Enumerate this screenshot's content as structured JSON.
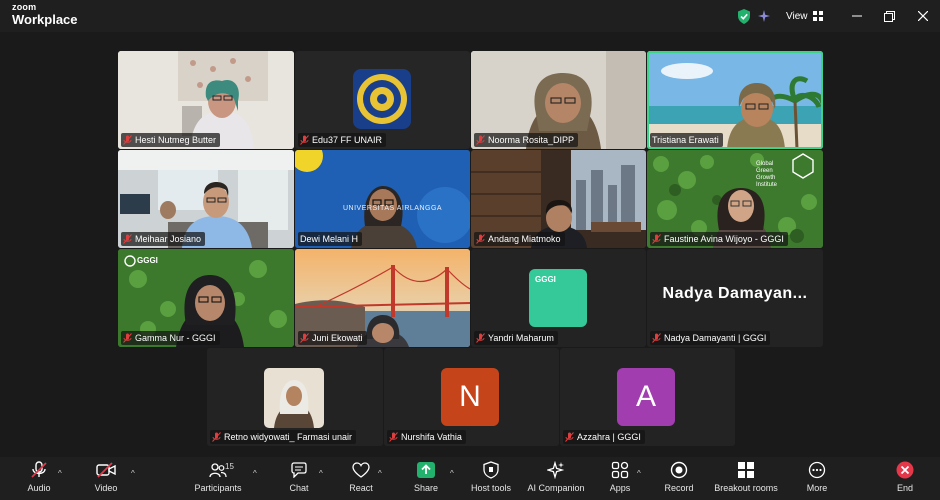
{
  "app": {
    "logo_line1": "zoom",
    "logo_line2": "Workplace"
  },
  "titlebar": {
    "view_label": "View"
  },
  "participants": [
    {
      "name": "Hesti Nutmeg Butter",
      "muted": true
    },
    {
      "name": "Edu37 FF UNAIR",
      "muted": true
    },
    {
      "name": "Noorma Rosita_DIPP",
      "muted": true
    },
    {
      "name": "Tristiana Erawati",
      "muted": false,
      "active": true
    },
    {
      "name": "Meihaar Josiano",
      "muted": true
    },
    {
      "name": "Dewi Melani H",
      "muted": false
    },
    {
      "name": "Andang Miatmoko",
      "muted": true
    },
    {
      "name": "Faustine Avina Wijoyo - GGGI",
      "muted": true
    },
    {
      "name": "Gamma Nur - GGGI",
      "muted": true
    },
    {
      "name": "Juni Ekowati",
      "muted": true
    },
    {
      "name": "Yandri Maharum",
      "muted": true
    },
    {
      "name": "Nadya Damayanti | GGGI",
      "muted": true,
      "display_text": "Nadya  Damayan..."
    },
    {
      "name": "Retno widyowati_ Farmasi unair",
      "muted": true
    },
    {
      "name": "Nurshifa Vathia",
      "muted": true,
      "avatar_letter": "N",
      "avatar_color": "#c6441a"
    },
    {
      "name": "Azzahra | GGGI",
      "muted": true,
      "avatar_letter": "A",
      "avatar_color": "#a23db0"
    }
  ],
  "tile_text": {
    "gggi_logo": "GGGI",
    "faustine_logo": "Global Green Growth Institute",
    "dewi_banner": "UNIVERSITAS AIRLANGGA"
  },
  "toolbar": {
    "audio": "Audio",
    "video": "Video",
    "participants": "Participants",
    "participants_count": "15",
    "chat": "Chat",
    "react": "React",
    "share": "Share",
    "host_tools": "Host tools",
    "ai_companion": "AI Companion",
    "apps": "Apps",
    "record": "Record",
    "breakout": "Breakout rooms",
    "more": "More",
    "end": "End"
  },
  "colors": {
    "accent_green": "#23b26d",
    "active_border": "#3fd28b",
    "end_red": "#e5374a",
    "gggi_green": "#35c99a"
  }
}
